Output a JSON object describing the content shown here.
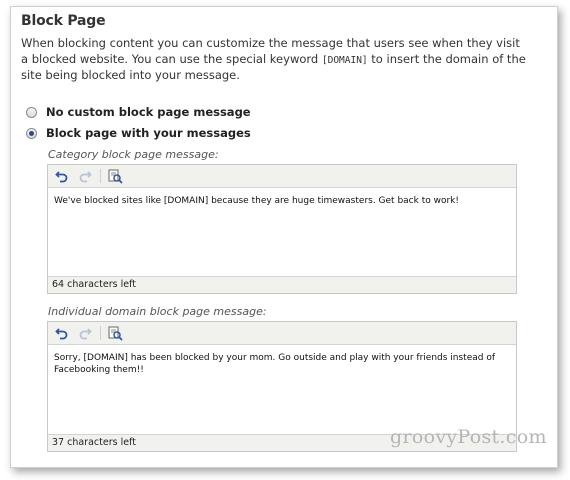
{
  "section": {
    "title": "Block Page",
    "description_part1": "When blocking content you can customize the message that users see when they visit a blocked website. You can use the special keyword ",
    "keyword": "[DOMAIN]",
    "description_part2": " to insert the domain of the site being blocked into your message."
  },
  "options": [
    {
      "label": "No custom block page message",
      "selected": false
    },
    {
      "label": "Block page with your messages",
      "selected": true
    }
  ],
  "category_editor": {
    "label": "Category block page message:",
    "text": "We've blocked sites like [DOMAIN] because they are huge timewasters. Get back to work!",
    "counter": "64 characters left"
  },
  "domain_editor": {
    "label": "Individual domain block page message:",
    "text": "Sorry, [DOMAIN] has been blocked by your mom. Go outside and play with your friends instead of Facebooking them!!",
    "counter": "37 characters left"
  },
  "toolbar_icons": [
    "undo-icon",
    "redo-icon",
    "spellcheck-icon"
  ],
  "watermark": "groovyPost.com",
  "colors": {
    "accent": "#2b4a8a",
    "toolbar_bg": "#f1f1ed"
  }
}
